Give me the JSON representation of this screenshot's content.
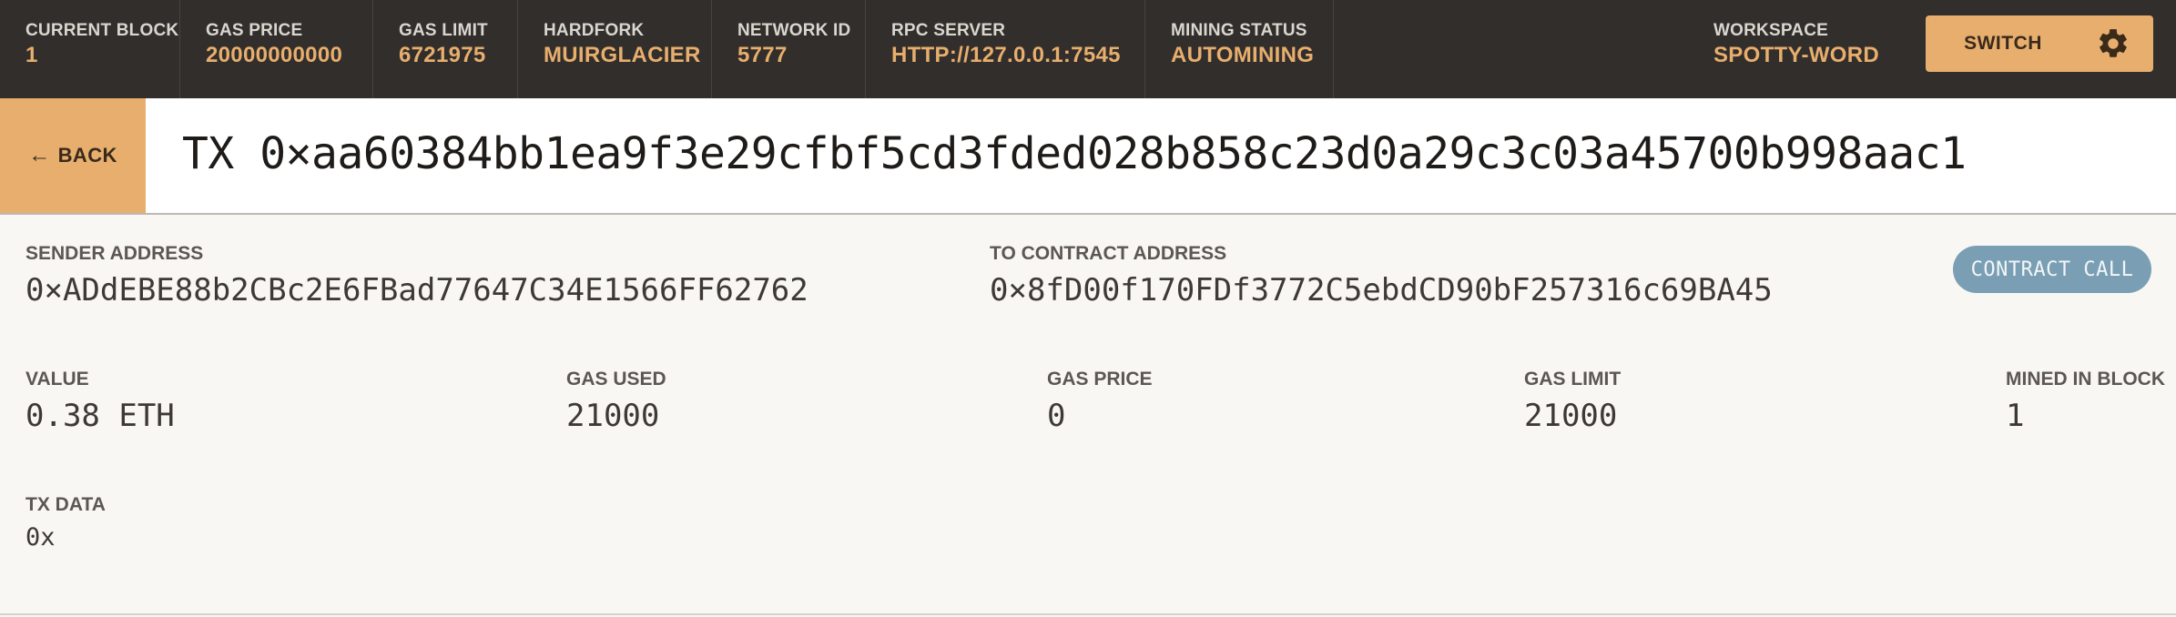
{
  "topbar": {
    "current_block": {
      "label": "CURRENT BLOCK",
      "value": "1"
    },
    "gas_price": {
      "label": "GAS PRICE",
      "value": "20000000000"
    },
    "gas_limit": {
      "label": "GAS LIMIT",
      "value": "6721975"
    },
    "hardfork": {
      "label": "HARDFORK",
      "value": "MUIRGLACIER"
    },
    "network_id": {
      "label": "NETWORK ID",
      "value": "5777"
    },
    "rpc_server": {
      "label": "RPC SERVER",
      "value": "HTTP://127.0.0.1:7545"
    },
    "mining_status": {
      "label": "MINING STATUS",
      "value": "AUTOMINING"
    },
    "workspace": {
      "label": "WORKSPACE",
      "value": "SPOTTY-WORD"
    },
    "switch_label": "SWITCH",
    "settings_icon": "gear-icon"
  },
  "header": {
    "back_arrow": "←",
    "back_label": "BACK",
    "tx_title": "TX 0×aa60384bb1ea9f3e29cfbf5cd3fded028b858c23d0a29c3c03a45700b998aac1"
  },
  "details": {
    "sender": {
      "label": "SENDER ADDRESS",
      "value": "0×ADdEBE88b2CBc2E6FBad77647C34E1566FF62762"
    },
    "to_contract": {
      "label": "TO CONTRACT ADDRESS",
      "value": "0×8fD00f170FDf3772C5ebdCD90bF257316c69BA45"
    },
    "badge": "CONTRACT CALL",
    "value": {
      "label": "VALUE",
      "value": "0.38 ETH"
    },
    "gas_used": {
      "label": "GAS USED",
      "value": "21000"
    },
    "gas_price": {
      "label": "GAS PRICE",
      "value": "0"
    },
    "gas_limit": {
      "label": "GAS LIMIT",
      "value": "21000"
    },
    "mined_in_block": {
      "label": "MINED IN BLOCK",
      "value": "1"
    },
    "tx_data": {
      "label": "TX DATA",
      "value": "0x"
    }
  },
  "colors": {
    "topbar_bg": "#322e2b",
    "accent": "#e7ae6e",
    "badge": "#7a9fb4",
    "page_bg": "#f8f7f4"
  }
}
